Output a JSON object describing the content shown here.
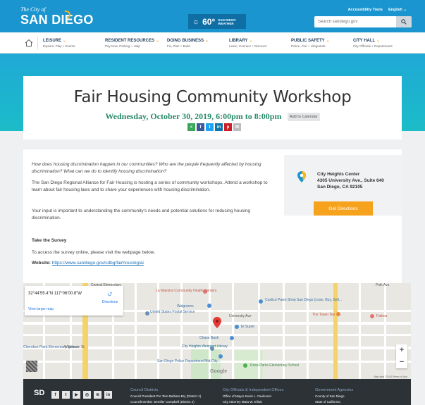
{
  "header": {
    "logo_small": "The City of",
    "logo_big": "SAN DIEGO",
    "weather_temp": "60°",
    "weather_label": "SAN DIEGO WEATHER",
    "accessibility": "Accessibility Tools",
    "language": "English",
    "search_placeholder": "Search sandiego.gov",
    "colors": {
      "header_bg": "#1a95d0",
      "accent": "#f7b61b"
    }
  },
  "nav": {
    "items": [
      {
        "title": "LEISURE",
        "sub": "Explore, Play + Events"
      },
      {
        "title": "RESIDENT RESOURCES",
        "sub": "Pay Now, Parking + Help"
      },
      {
        "title": "DOING BUSINESS",
        "sub": "Fix, Plan + Build"
      },
      {
        "title": "LIBRARY",
        "sub": "Learn, Connect + Discover"
      },
      {
        "title": "PUBLIC SAFETY",
        "sub": "Police, Fire + Lifeguards"
      },
      {
        "title": "CITY HALL",
        "sub": "City Officials + Departments"
      }
    ]
  },
  "event": {
    "title": "Fair Housing Community Workshop",
    "date": "Wednesday, October 30, 2019, 6:00pm to 8:00pm",
    "add_calendar": "Add to Calendar",
    "share_icons": [
      "share-icon",
      "facebook-icon",
      "twitter-icon",
      "linkedin-icon",
      "pinterest-icon",
      "email-icon"
    ]
  },
  "content": {
    "intro": "How does housing discrimination happen in our communities? Who are the people frequently affected by housing discrimination? What can we do to identify housing discrimination?",
    "p1": "The San Diego Regional Alliance for Fair Housing is hosting a series of community workshops. Attend a workshop to learn about fair housing laws and to share your experiences with housing discrimination.",
    "p2": "Your input is important to understanding the community's needs and potential solutions for reducing housing discrimination.",
    "survey_heading": "Take the Survey",
    "survey_text": "To access the survey online, please visit the webpage below.",
    "website_label": "Website:",
    "website_url": "https://www.sandiego.gov/cdbg/fairhousing/ai"
  },
  "location": {
    "name": "City Heights Center",
    "address1": "4305 University Ave., Suite 640",
    "address2": "San Diego, CA 92105",
    "button": "Get Directions"
  },
  "map": {
    "coords": "32°44'55.4\"N 117°06'00.8\"W",
    "larger": "View larger map",
    "directions": "Directions",
    "labels": {
      "library": "La Maestra Community Health Centers",
      "walgreens": "Walgreens",
      "usps": "United States Postal Service",
      "castico": "Castico Pawn Shop San Diego (Loan, Buy, Sell...",
      "tower": "The Tower Bar",
      "fatima": "Fatima",
      "elsuper": "El Super",
      "chase": "Chase Bank",
      "weingart": "City Heights Weingart Library",
      "police": "San Diego Police Department Mid-City...",
      "rosa": "Rosa Parks Elementary School",
      "cherokee": "Cherokee Point Elementary School",
      "central": "Central Elementary",
      "university": "University Ave",
      "wightman": "Wightman St",
      "polk": "Polk Ave"
    },
    "google": "Google",
    "mapdata": "Map data ©2019   Terms of Use"
  },
  "footer": {
    "logo": "SD",
    "cols": [
      {
        "head": "Council Districts",
        "l1": "Council President Pro Tem Barbara Bry (District 1)",
        "l2": "Councilmember Jennifer Campbell (District 2)"
      },
      {
        "head": "City Officials & Independent Offices",
        "l1": "Office of Mayor Kevin L. Faulconer",
        "l2": "City Attorney Mara W. Elliott"
      },
      {
        "head": "Government Agencies",
        "l1": "County of San Diego",
        "l2": "State of California"
      }
    ]
  }
}
